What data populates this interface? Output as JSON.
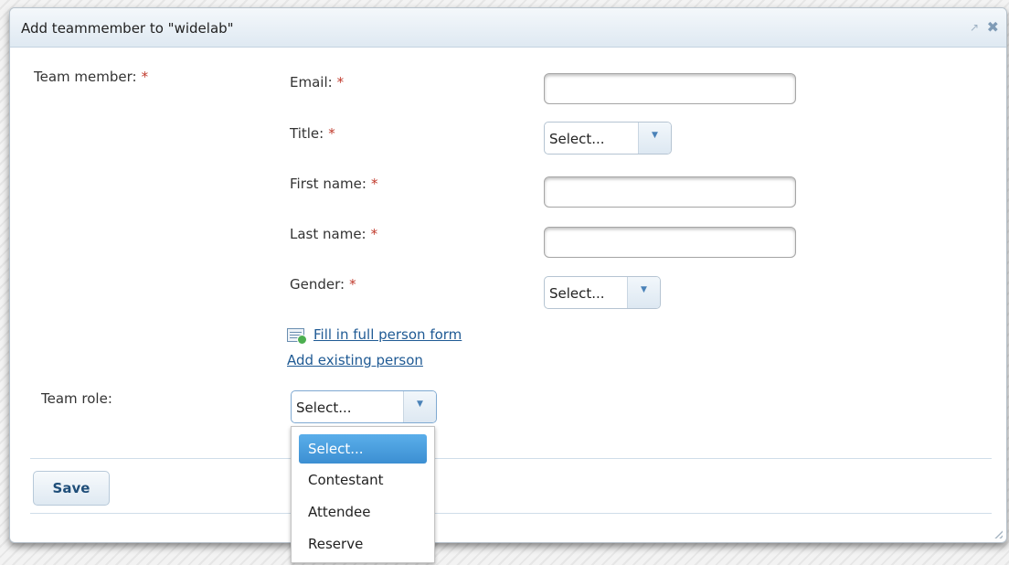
{
  "dialog": {
    "title": "Add teammember to \"widelab\"",
    "popout_icon": "popout-icon",
    "close_icon": "close-icon"
  },
  "form": {
    "team_member_label": "Team member:",
    "required_mark": "*",
    "email_label": "Email:",
    "email_value": "",
    "title_label": "Title:",
    "title_value": "Select...",
    "first_name_label": "First name:",
    "first_name_value": "",
    "last_name_label": "Last name:",
    "last_name_value": "",
    "gender_label": "Gender:",
    "gender_value": "Select...",
    "fill_full_form_link": "Fill in full person form",
    "add_existing_link": "Add existing person",
    "team_role_label": "Team role:",
    "team_role_value": "Select..."
  },
  "team_role_options": [
    "Select...",
    "Contestant",
    "Attendee",
    "Reserve"
  ],
  "actions": {
    "save_label": "Save"
  },
  "colors": {
    "accent": "#3c8fd2",
    "required": "#c0392b",
    "link": "#1f5a94"
  }
}
